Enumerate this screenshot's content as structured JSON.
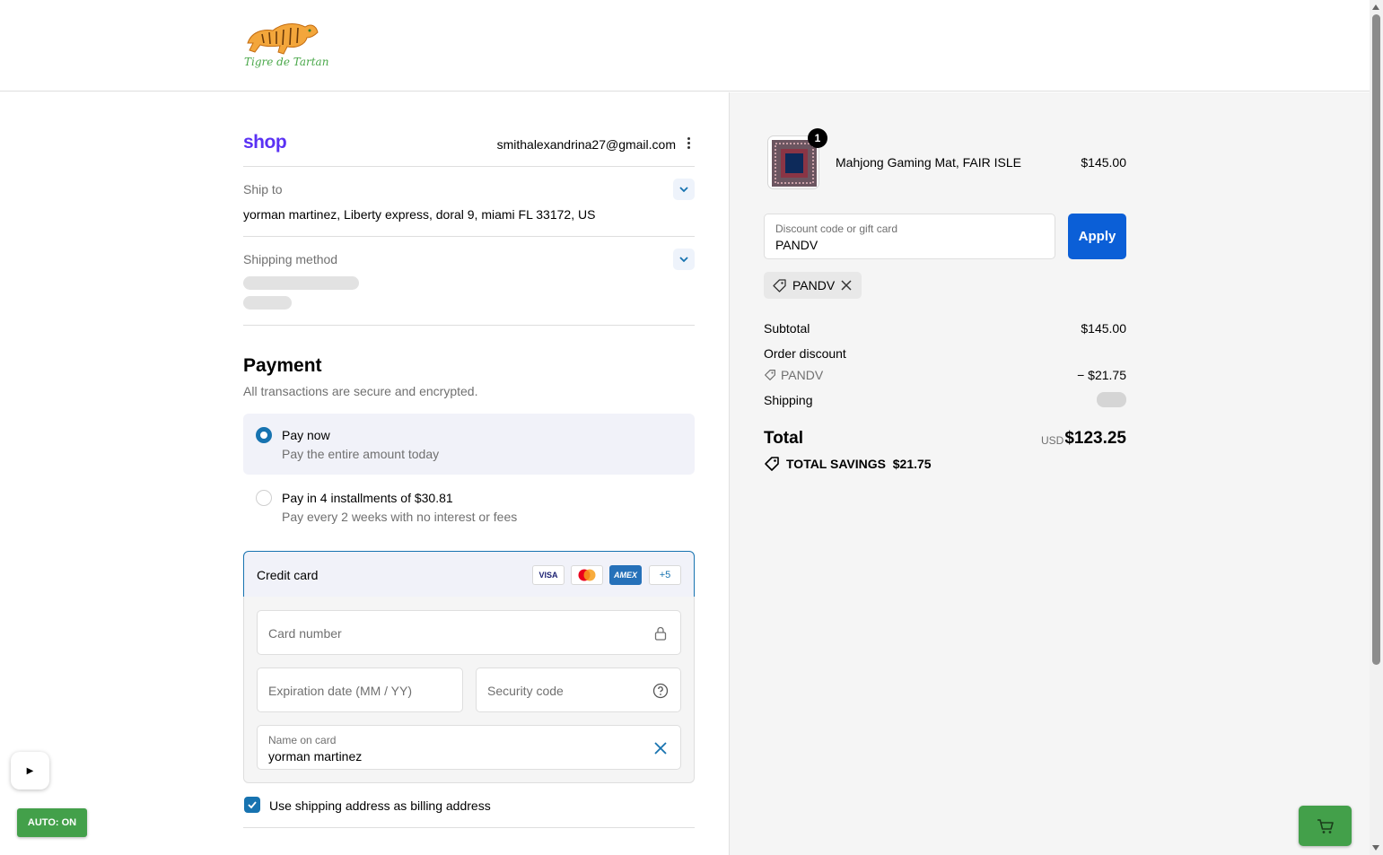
{
  "store": {
    "logo_text": "Tigre de Tartan"
  },
  "account": {
    "shop_brand": "shop",
    "email": "smithalexandrina27@gmail.com"
  },
  "ship_to": {
    "label": "Ship to",
    "address": "yorman martinez, Liberty express, doral 9, miami FL 33172, US"
  },
  "shipping_method": {
    "label": "Shipping method"
  },
  "payment": {
    "title": "Payment",
    "subtitle": "All transactions are secure and encrypted.",
    "options": [
      {
        "title": "Pay now",
        "description": "Pay the entire amount today",
        "selected": true
      },
      {
        "title": "Pay in 4 installments of $30.81",
        "description": "Pay every 2 weeks with no interest or fees",
        "selected": false
      }
    ],
    "credit_card": {
      "label": "Credit card",
      "brands": [
        "VISA",
        "Mastercard",
        "AMEX"
      ],
      "more_brands": "+5",
      "card_number_placeholder": "Card number",
      "expiry_placeholder": "Expiration date (MM / YY)",
      "security_placeholder": "Security code",
      "name_label": "Name on card",
      "name_value": "yorman martinez"
    },
    "billing_checkbox_label": "Use shipping address as billing address",
    "billing_checked": true
  },
  "summary": {
    "product": {
      "name": "Mahjong Gaming Mat, FAIR ISLE",
      "price": "$145.00",
      "quantity": "1"
    },
    "discount_field": {
      "label": "Discount code or gift card",
      "value": "PANDV"
    },
    "apply_label": "Apply",
    "applied_code": "PANDV",
    "subtotal_label": "Subtotal",
    "subtotal_value": "$145.00",
    "order_discount_label": "Order discount",
    "discount_code": "PANDV",
    "discount_value": "− $21.75",
    "shipping_label": "Shipping",
    "total_label": "Total",
    "total_currency": "USD",
    "total_value": "$123.25",
    "savings_label": "TOTAL SAVINGS",
    "savings_value": "$21.75"
  },
  "overlay": {
    "auto_label": "AUTO: ON",
    "play_glyph": "▶"
  },
  "colors": {
    "accent": "#1773b0",
    "apply_button": "#0b5fd7",
    "shop_purple": "#5a31f4",
    "overlay_green": "#43a04a"
  }
}
